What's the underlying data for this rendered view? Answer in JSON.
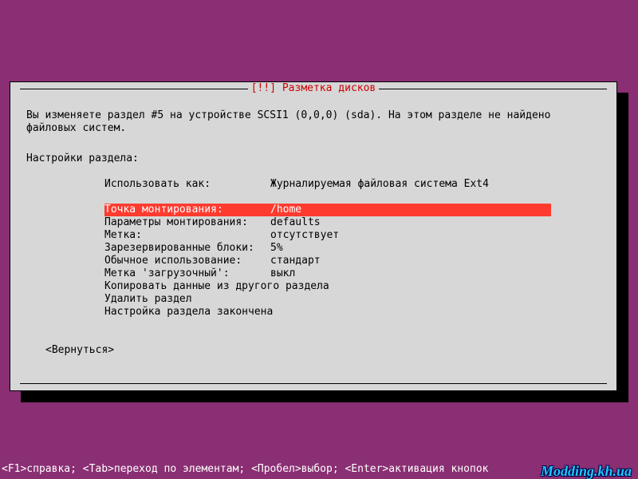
{
  "dialog": {
    "title": "[!!] Разметка дисков",
    "intro_line1": "Вы изменяете раздел #5 на устройстве SCSI1 (0,0,0) (sda). На этом разделе не найдено",
    "intro_line2": "файловых систем.",
    "settings_heading": "Настройки раздела:",
    "rows": [
      {
        "label": "Использовать как:",
        "value": "Журналируемая файловая система Ext4",
        "selected": false
      },
      {
        "spacer": true
      },
      {
        "label": "Точка монтирования:",
        "value": "/home",
        "selected": true
      },
      {
        "label": "Параметры монтирования:",
        "value": "defaults",
        "selected": false
      },
      {
        "label": "Метка:",
        "value": "отсутствует",
        "selected": false
      },
      {
        "label": "Зарезервированные блоки:",
        "value": "5%",
        "selected": false
      },
      {
        "label": "Обычное использование:",
        "value": "стандарт",
        "selected": false
      },
      {
        "label": "Метка 'загрузочный':",
        "value": "выкл",
        "selected": false
      }
    ],
    "actions": [
      "Копировать данные из другого раздела",
      "Удалить раздел",
      "Настройка раздела закончена"
    ],
    "back": "<Вернуться>"
  },
  "footer": "<F1>справка; <Tab>переход по элементам; <Пробел>выбор; <Enter>активация кнопок",
  "watermark": "Modding.kh.ua"
}
